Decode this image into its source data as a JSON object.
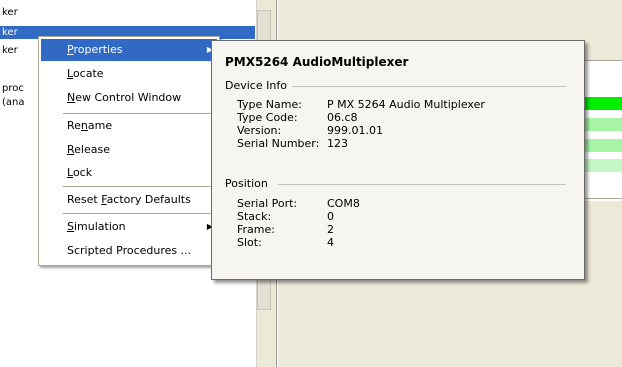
{
  "tree": {
    "rows": [
      {
        "text": "ker",
        "selected": false
      },
      {
        "text": "ker",
        "selected": true
      },
      {
        "text": "ker",
        "selected": false
      },
      {
        "text": "proc",
        "selected": false
      },
      {
        "text": "(ana",
        "selected": false
      }
    ]
  },
  "context_menu": {
    "items": [
      {
        "pre": "",
        "mnemonic": "P",
        "post": "roperties",
        "submenu": true,
        "highlighted": true
      },
      {
        "pre": "",
        "mnemonic": "L",
        "post": "ocate",
        "submenu": false,
        "highlighted": false
      },
      {
        "pre": "",
        "mnemonic": "N",
        "post": "ew Control Window",
        "submenu": false,
        "highlighted": false
      },
      {
        "pre": "Re",
        "mnemonic": "n",
        "post": "ame",
        "submenu": false,
        "highlighted": false
      },
      {
        "pre": "",
        "mnemonic": "R",
        "post": "elease",
        "submenu": false,
        "highlighted": false
      },
      {
        "pre": "",
        "mnemonic": "L",
        "post": "ock",
        "submenu": false,
        "highlighted": false
      },
      {
        "pre": "Reset ",
        "mnemonic": "F",
        "post": "actory Defaults",
        "submenu": false,
        "highlighted": false
      },
      {
        "pre": "",
        "mnemonic": "S",
        "post": "imulation",
        "submenu": true,
        "highlighted": false
      },
      {
        "pre": "Scripted Procedures ...",
        "mnemonic": "",
        "post": "",
        "submenu": false,
        "highlighted": false
      }
    ],
    "arrow_glyph": "▶"
  },
  "tooltip": {
    "title": "PMX5264 AudioMultiplexer",
    "device_info": {
      "header": "Device Info",
      "fields": [
        {
          "label": "Type Name:",
          "value": "P MX 5264 Audio Multiplexer"
        },
        {
          "label": "Type Code:",
          "value": "06.c8"
        },
        {
          "label": "Version:",
          "value": "999.01.01"
        },
        {
          "label": "Serial Number:",
          "value": "123"
        }
      ]
    },
    "position": {
      "header": "Position",
      "fields": [
        {
          "label": "Serial Port:",
          "value": "COM8"
        },
        {
          "label": "Stack:",
          "value": "0"
        },
        {
          "label": "Frame:",
          "value": "2"
        },
        {
          "label": "Slot:",
          "value": "4"
        }
      ]
    }
  },
  "colors": {
    "selection": "#316ac5",
    "green_bright": "#00ee00",
    "green_light": "#a6f5a6",
    "green_pale": "#c4f7c4"
  }
}
